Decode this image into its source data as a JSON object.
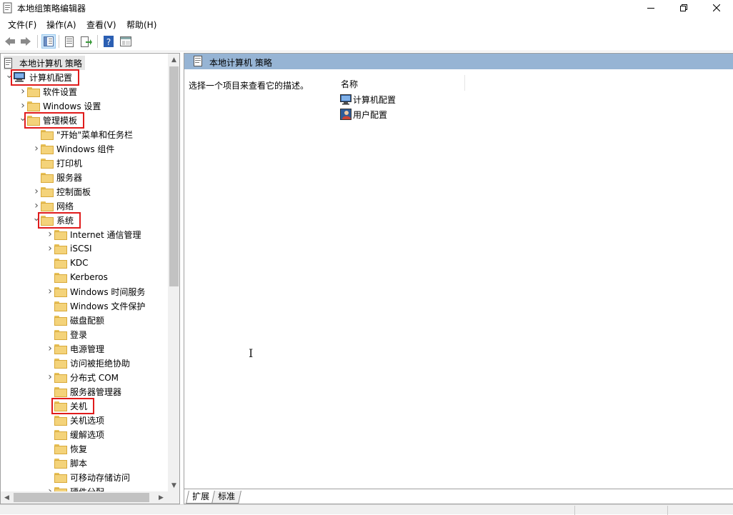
{
  "window": {
    "title": "本地组策略编辑器"
  },
  "menu": {
    "file": "文件(F)",
    "action": "操作(A)",
    "view": "查看(V)",
    "help": "帮助(H)"
  },
  "tree": {
    "root": "本地计算机 策略",
    "items": [
      {
        "label": "计算机配置",
        "level": 0,
        "expander": "expanded",
        "icon": "computer-icon",
        "highlighted": true
      },
      {
        "label": "软件设置",
        "level": 1,
        "expander": "collapsed",
        "icon": "folder-icon",
        "highlighted": false
      },
      {
        "label": "Windows 设置",
        "level": 1,
        "expander": "collapsed",
        "icon": "folder-icon",
        "highlighted": false
      },
      {
        "label": "管理模板",
        "level": 1,
        "expander": "expanded",
        "icon": "folder-icon",
        "highlighted": true
      },
      {
        "label": "\"开始\"菜单和任务栏",
        "level": 2,
        "expander": "none",
        "icon": "folder-icon",
        "highlighted": false
      },
      {
        "label": "Windows 组件",
        "level": 2,
        "expander": "collapsed",
        "icon": "folder-icon",
        "highlighted": false
      },
      {
        "label": "打印机",
        "level": 2,
        "expander": "none",
        "icon": "folder-icon",
        "highlighted": false
      },
      {
        "label": "服务器",
        "level": 2,
        "expander": "none",
        "icon": "folder-icon",
        "highlighted": false
      },
      {
        "label": "控制面板",
        "level": 2,
        "expander": "collapsed",
        "icon": "folder-icon",
        "highlighted": false
      },
      {
        "label": "网络",
        "level": 2,
        "expander": "collapsed",
        "icon": "folder-icon",
        "highlighted": false
      },
      {
        "label": "系统",
        "level": 2,
        "expander": "expanded",
        "icon": "folder-icon",
        "highlighted": true
      },
      {
        "label": "Internet 通信管理",
        "level": 3,
        "expander": "collapsed",
        "icon": "folder-icon",
        "highlighted": false
      },
      {
        "label": "iSCSI",
        "level": 3,
        "expander": "collapsed",
        "icon": "folder-icon",
        "highlighted": false
      },
      {
        "label": "KDC",
        "level": 3,
        "expander": "none",
        "icon": "folder-icon",
        "highlighted": false
      },
      {
        "label": "Kerberos",
        "level": 3,
        "expander": "none",
        "icon": "folder-icon",
        "highlighted": false
      },
      {
        "label": "Windows 时间服务",
        "level": 3,
        "expander": "collapsed",
        "icon": "folder-icon",
        "highlighted": false
      },
      {
        "label": "Windows 文件保护",
        "level": 3,
        "expander": "none",
        "icon": "folder-icon",
        "highlighted": false
      },
      {
        "label": "磁盘配额",
        "level": 3,
        "expander": "none",
        "icon": "folder-icon",
        "highlighted": false
      },
      {
        "label": "登录",
        "level": 3,
        "expander": "none",
        "icon": "folder-icon",
        "highlighted": false
      },
      {
        "label": "电源管理",
        "level": 3,
        "expander": "collapsed",
        "icon": "folder-icon",
        "highlighted": false
      },
      {
        "label": "访问被拒绝协助",
        "level": 3,
        "expander": "none",
        "icon": "folder-icon",
        "highlighted": false
      },
      {
        "label": "分布式 COM",
        "level": 3,
        "expander": "collapsed",
        "icon": "folder-icon",
        "highlighted": false
      },
      {
        "label": "服务器管理器",
        "level": 3,
        "expander": "none",
        "icon": "folder-icon",
        "highlighted": false
      },
      {
        "label": "关机",
        "level": 3,
        "expander": "none",
        "icon": "folder-icon",
        "highlighted": true
      },
      {
        "label": "关机选项",
        "level": 3,
        "expander": "none",
        "icon": "folder-icon",
        "highlighted": false
      },
      {
        "label": "缓解选项",
        "level": 3,
        "expander": "none",
        "icon": "folder-icon",
        "highlighted": false
      },
      {
        "label": "恢复",
        "level": 3,
        "expander": "none",
        "icon": "folder-icon",
        "highlighted": false
      },
      {
        "label": "脚本",
        "level": 3,
        "expander": "none",
        "icon": "folder-icon",
        "highlighted": false
      },
      {
        "label": "可移动存储访问",
        "level": 3,
        "expander": "none",
        "icon": "folder-icon",
        "highlighted": false
      },
      {
        "label": "硬件分配",
        "level": 3,
        "expander": "collapsed",
        "icon": "folder-icon",
        "highlighted": false
      }
    ]
  },
  "right": {
    "header_title": "本地计算机 策略",
    "description": "选择一个项目来查看它的描述。",
    "column_name": "名称",
    "items": [
      {
        "label": "计算机配置",
        "icon": "computer-icon"
      },
      {
        "label": "用户配置",
        "icon": "user-icon"
      }
    ]
  },
  "tabs": {
    "extended": "扩展",
    "standard": "标准"
  },
  "colors": {
    "header_bg": "#96b4d4",
    "highlight_box": "#e01c1c",
    "folder": "#f4d37a"
  }
}
